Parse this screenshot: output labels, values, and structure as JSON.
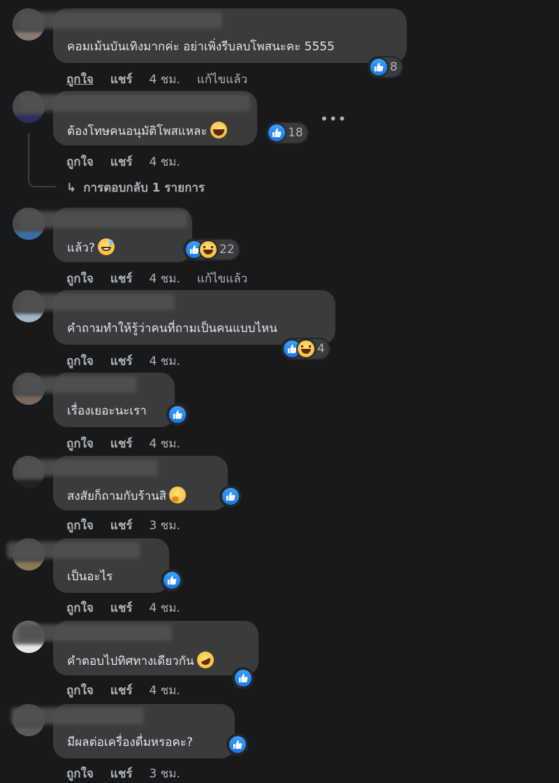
{
  "actions": {
    "like": "ถูกใจ",
    "share": "แชร์",
    "edited": "แก้ไขแล้ว"
  },
  "reply_link": {
    "arrow": "↳",
    "text": "การตอบกลับ 1 รายการ"
  },
  "more_menu": "•••",
  "comments": [
    {
      "text": "คอมเม้นบันเทิงมากค่ะ อย่าเพิ่งรีบลบโพสนะคะ 5555",
      "reactions": [
        "like"
      ],
      "count": "8",
      "time": "4 ชม.",
      "edited": true
    },
    {
      "text": "ต้องโทษคนอนุมัติโพสแหละ",
      "emoji": "xd",
      "reactions": [
        "like"
      ],
      "count": "18",
      "time": "4 ชม.",
      "edited": false
    },
    {
      "text": "แล้ว?",
      "emoji": "grin-sweat",
      "reactions": [
        "like",
        "haha"
      ],
      "count": "22",
      "time": "4 ชม.",
      "edited": true
    },
    {
      "text": "คำถามทำให้รู้ว่าคนที่ถามเป็นคนแบบไหน",
      "reactions": [
        "like",
        "haha"
      ],
      "count": "4",
      "time": "4 ชม.",
      "edited": false
    },
    {
      "text": "เรื่องเยอะนะเรา",
      "reactions": [
        "like"
      ],
      "count": "",
      "time": "4 ชม.",
      "edited": false
    },
    {
      "text": "สงสัยก็ถามกับร้านสิ",
      "emoji": "thinking",
      "reactions": [
        "like"
      ],
      "count": "",
      "time": "3 ชม.",
      "edited": false
    },
    {
      "text": "เป็นอะไร",
      "reactions": [
        "like"
      ],
      "count": "",
      "time": "4 ชม.",
      "edited": false
    },
    {
      "text": "คำตอบไปทิศทางเดียวกัน",
      "emoji": "rofl",
      "reactions": [
        "like"
      ],
      "count": "",
      "time": "4 ชม.",
      "edited": false
    },
    {
      "text": "มีผลต่อเครื่องดื่มหรอคะ?",
      "reactions": [
        "like"
      ],
      "count": "",
      "time": "3 ชม.",
      "edited": false
    }
  ],
  "colors": {
    "background": "#18191a",
    "bubble": "#3a3b3c",
    "text": "#e4e6eb",
    "muted": "#b0b3b8",
    "like_blue": "#1877f2"
  }
}
